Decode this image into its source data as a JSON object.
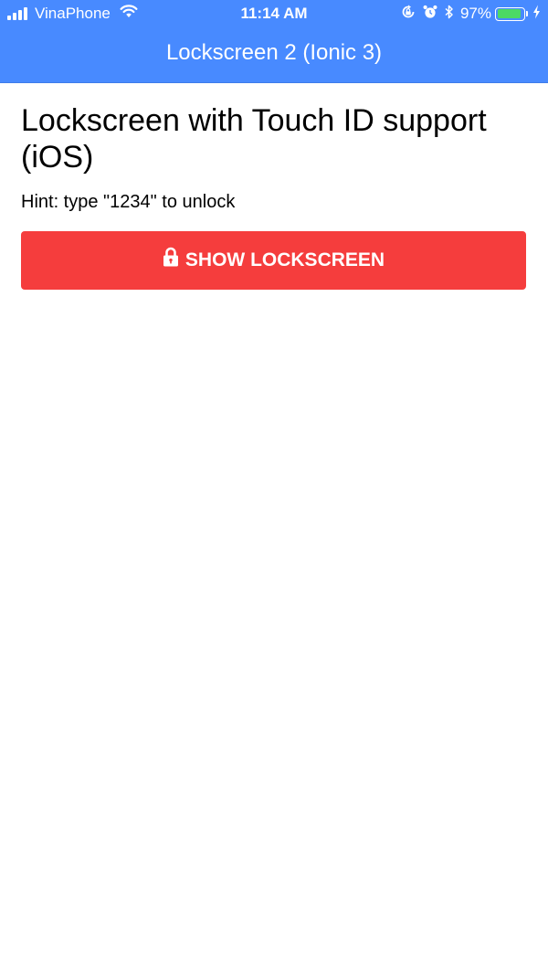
{
  "status_bar": {
    "carrier": "VinaPhone",
    "time": "11:14 AM",
    "battery_percent": "97%",
    "battery_level": 0.97,
    "icons": [
      "signal-icon",
      "wifi-icon",
      "orientation-lock-icon",
      "alarm-icon",
      "bluetooth-icon",
      "battery-icon",
      "charging-icon"
    ]
  },
  "navbar": {
    "title": "Lockscreen 2 (Ionic 3)"
  },
  "main": {
    "title": "Lockscreen with Touch ID support (iOS)",
    "hint": "Hint: type \"1234\" to unlock",
    "button_label": "SHOW LOCKSCREEN",
    "button_icon": "lock-icon"
  },
  "colors": {
    "primary": "#488aff",
    "danger": "#f53d3d",
    "battery": "#4cd964"
  }
}
